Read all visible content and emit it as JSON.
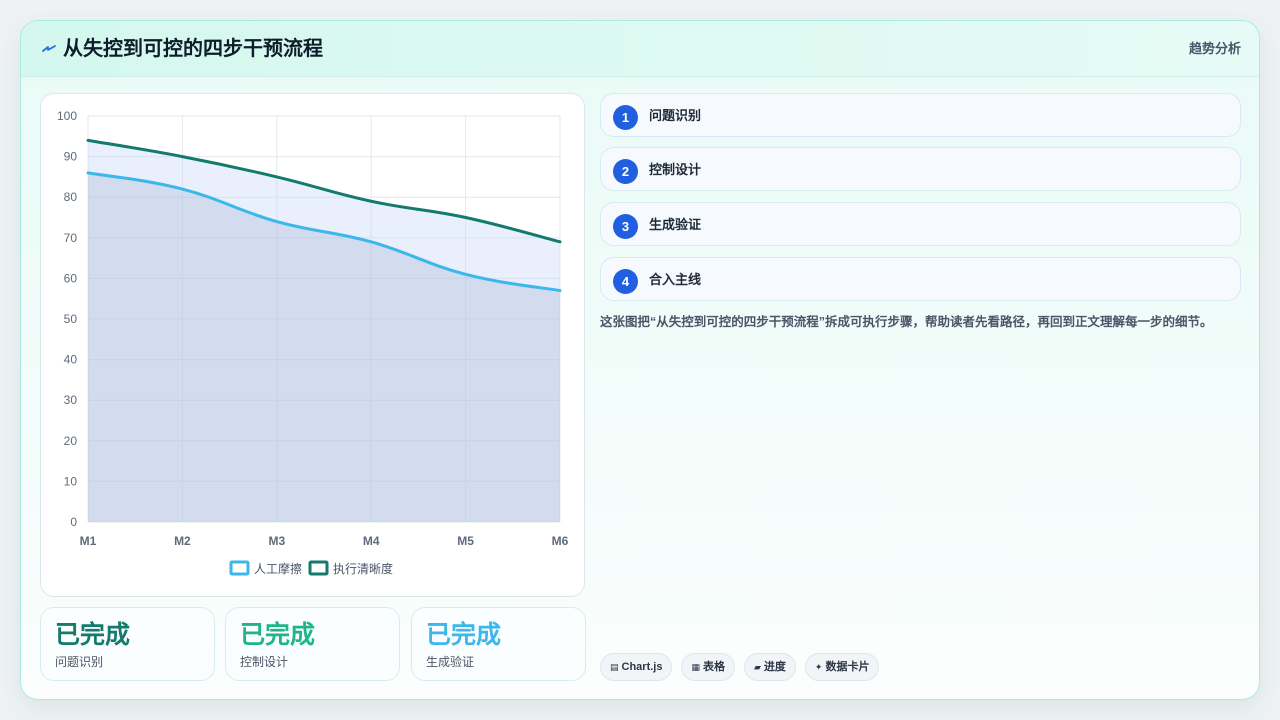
{
  "header": {
    "icon": "lightning-icon",
    "title": "从失控到可控的四步干预流程",
    "right_label": "趋势分析"
  },
  "chart_data": {
    "type": "line",
    "x": [
      "M1",
      "M2",
      "M3",
      "M4",
      "M5",
      "M6"
    ],
    "ylim": [
      0,
      100
    ],
    "yticks": [
      0,
      10,
      20,
      30,
      40,
      50,
      60,
      70,
      80,
      90,
      100
    ],
    "grid": true,
    "legend_position": "bottom",
    "series": [
      {
        "name": "人工摩擦",
        "values": [
          86,
          82,
          74,
          69,
          61,
          57
        ],
        "color": "#3bb7ea",
        "fill": true
      },
      {
        "name": "执行清晰度",
        "values": [
          94,
          90,
          85,
          79,
          75,
          69
        ],
        "color": "#137a6c",
        "fill": true
      }
    ]
  },
  "stats": [
    {
      "value": "已完成",
      "label": "问题识别",
      "color": "#137a6c"
    },
    {
      "value": "已完成",
      "label": "控制设计",
      "color": "#1fb589"
    },
    {
      "value": "已完成",
      "label": "生成验证",
      "color": "#3bb7ea"
    }
  ],
  "steps": [
    {
      "num": "1",
      "label": "问题识别"
    },
    {
      "num": "2",
      "label": "控制设计"
    },
    {
      "num": "3",
      "label": "生成验证"
    },
    {
      "num": "4",
      "label": "合入主线"
    }
  ],
  "description": "这张图把“从失控到可控的四步干预流程”拆成可执行步骤，帮助读者先看路径，再回到正文理解每一步的细节。",
  "tags": [
    {
      "icon": "chart-icon",
      "label": "Chart.js"
    },
    {
      "icon": "table-icon",
      "label": "表格"
    },
    {
      "icon": "progress-icon",
      "label": "进度"
    },
    {
      "icon": "data-card-icon",
      "label": "数据卡片"
    }
  ]
}
